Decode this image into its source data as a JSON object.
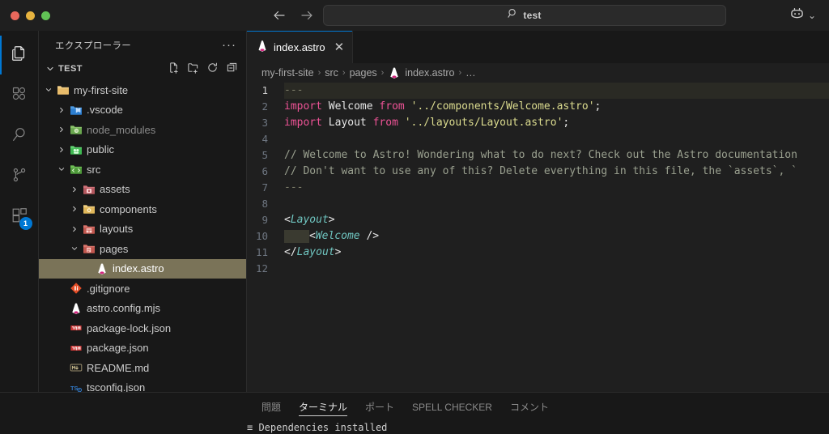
{
  "titlebar": {
    "back_label": "←",
    "forward_label": "→",
    "search_value": "test",
    "search_icon": "search-icon",
    "copilot_icon": "copilot-icon",
    "copilot_chevron": "⌄"
  },
  "activitybar": {
    "items": [
      {
        "name": "explorer",
        "icon": "files-icon",
        "active": true,
        "badge": ""
      },
      {
        "name": "figma",
        "icon": "figma-icon",
        "active": false,
        "badge": ""
      },
      {
        "name": "search",
        "icon": "search-icon",
        "active": false,
        "badge": ""
      },
      {
        "name": "source-control",
        "icon": "source-control-icon",
        "active": false,
        "badge": ""
      },
      {
        "name": "extensions",
        "icon": "extensions-icon",
        "active": false,
        "badge": "1"
      }
    ]
  },
  "sidebar": {
    "title": "エクスプローラー",
    "more_label": "···",
    "section": {
      "label": "TEST",
      "expanded": true,
      "actions": [
        {
          "name": "new-file",
          "label": "新しいファイル"
        },
        {
          "name": "new-folder",
          "label": "新しいフォルダー"
        },
        {
          "name": "refresh",
          "label": "最新の情報に更新"
        },
        {
          "name": "collapse-all",
          "label": "フォルダーを折りたたむ"
        }
      ]
    },
    "tree": [
      {
        "label": "my-first-site",
        "type": "folder",
        "icon": "folder-open-icon",
        "indent": 1,
        "expanded": true,
        "selected": false,
        "dim": false
      },
      {
        "label": ".vscode",
        "type": "folder",
        "icon": "folder-vscode-icon",
        "indent": 2,
        "expanded": false,
        "selected": false,
        "dim": false
      },
      {
        "label": "node_modules",
        "type": "folder",
        "icon": "folder-node-icon",
        "indent": 2,
        "expanded": false,
        "selected": false,
        "dim": true
      },
      {
        "label": "public",
        "type": "folder",
        "icon": "folder-public-icon",
        "indent": 2,
        "expanded": false,
        "selected": false,
        "dim": false
      },
      {
        "label": "src",
        "type": "folder",
        "icon": "folder-src-icon",
        "indent": 2,
        "expanded": true,
        "selected": false,
        "dim": false
      },
      {
        "label": "assets",
        "type": "folder",
        "icon": "folder-assets-icon",
        "indent": 3,
        "expanded": false,
        "selected": false,
        "dim": false
      },
      {
        "label": "components",
        "type": "folder",
        "icon": "folder-components-icon",
        "indent": 3,
        "expanded": false,
        "selected": false,
        "dim": false
      },
      {
        "label": "layouts",
        "type": "folder",
        "icon": "folder-layouts-icon",
        "indent": 3,
        "expanded": false,
        "selected": false,
        "dim": false
      },
      {
        "label": "pages",
        "type": "folder",
        "icon": "folder-pages-icon",
        "indent": 3,
        "expanded": true,
        "selected": false,
        "dim": false
      },
      {
        "label": "index.astro",
        "type": "file",
        "icon": "astro-icon",
        "indent": 4,
        "expanded": null,
        "selected": true,
        "dim": false
      },
      {
        "label": ".gitignore",
        "type": "file",
        "icon": "git-icon",
        "indent": 2,
        "expanded": null,
        "selected": false,
        "dim": false
      },
      {
        "label": "astro.config.mjs",
        "type": "file",
        "icon": "astro-icon",
        "indent": 2,
        "expanded": null,
        "selected": false,
        "dim": false
      },
      {
        "label": "package-lock.json",
        "type": "file",
        "icon": "npm-icon",
        "indent": 2,
        "expanded": null,
        "selected": false,
        "dim": false
      },
      {
        "label": "package.json",
        "type": "file",
        "icon": "npm-icon",
        "indent": 2,
        "expanded": null,
        "selected": false,
        "dim": false
      },
      {
        "label": "README.md",
        "type": "file",
        "icon": "markdown-icon",
        "indent": 2,
        "expanded": null,
        "selected": false,
        "dim": false
      },
      {
        "label": "tsconfig.json",
        "type": "file",
        "icon": "tsconfig-icon",
        "indent": 2,
        "expanded": null,
        "selected": false,
        "dim": false
      }
    ]
  },
  "editor": {
    "tabs": [
      {
        "label": "index.astro",
        "icon": "astro-icon",
        "active": true,
        "close_label": "✕"
      }
    ],
    "breadcrumbs": [
      {
        "label": "my-first-site",
        "icon": ""
      },
      {
        "label": "src",
        "icon": ""
      },
      {
        "label": "pages",
        "icon": ""
      },
      {
        "label": "index.astro",
        "icon": "astro-icon"
      },
      {
        "label": "…",
        "icon": ""
      }
    ],
    "separator": "›",
    "lines": [
      {
        "num": "1",
        "highlight": true,
        "tokens": [
          {
            "t": "fm",
            "s": "---"
          }
        ]
      },
      {
        "num": "2",
        "highlight": false,
        "tokens": [
          {
            "t": "kw",
            "s": "import"
          },
          {
            "t": "plain",
            "s": " Welcome "
          },
          {
            "t": "kw",
            "s": "from"
          },
          {
            "t": "plain",
            "s": " "
          },
          {
            "t": "str",
            "s": "'../components/Welcome.astro'"
          },
          {
            "t": "punct",
            "s": ";"
          }
        ]
      },
      {
        "num": "3",
        "highlight": false,
        "tokens": [
          {
            "t": "kw",
            "s": "import"
          },
          {
            "t": "plain",
            "s": " Layout "
          },
          {
            "t": "kw",
            "s": "from"
          },
          {
            "t": "plain",
            "s": " "
          },
          {
            "t": "str",
            "s": "'../layouts/Layout.astro'"
          },
          {
            "t": "punct",
            "s": ";"
          }
        ]
      },
      {
        "num": "4",
        "highlight": false,
        "tokens": []
      },
      {
        "num": "5",
        "highlight": false,
        "tokens": [
          {
            "t": "cmt",
            "s": "// Welcome to Astro! Wondering what to do next? Check out the Astro documentation"
          }
        ]
      },
      {
        "num": "6",
        "highlight": false,
        "tokens": [
          {
            "t": "cmt",
            "s": "// Don't want to use any of this? Delete everything in this file, the `assets`, `"
          }
        ]
      },
      {
        "num": "7",
        "highlight": false,
        "tokens": [
          {
            "t": "fm",
            "s": "---"
          }
        ]
      },
      {
        "num": "8",
        "highlight": false,
        "tokens": []
      },
      {
        "num": "9",
        "highlight": false,
        "tokens": [
          {
            "t": "punct",
            "s": "<"
          },
          {
            "t": "tag",
            "s": "Layout"
          },
          {
            "t": "punct",
            "s": ">"
          }
        ]
      },
      {
        "num": "10",
        "highlight": false,
        "tokens": [
          {
            "t": "ws",
            "s": "    "
          },
          {
            "t": "punct",
            "s": "<"
          },
          {
            "t": "tag",
            "s": "Welcome"
          },
          {
            "t": "punct",
            "s": " />"
          }
        ]
      },
      {
        "num": "11",
        "highlight": false,
        "tokens": [
          {
            "t": "punct",
            "s": "</"
          },
          {
            "t": "tag",
            "s": "Layout"
          },
          {
            "t": "punct",
            "s": ">"
          }
        ]
      },
      {
        "num": "12",
        "highlight": false,
        "tokens": []
      }
    ]
  },
  "panel": {
    "tabs": [
      {
        "label": "問題",
        "active": false
      },
      {
        "label": "ターミナル",
        "active": true
      },
      {
        "label": "ポート",
        "active": false
      },
      {
        "label": "SPELL CHECKER",
        "active": false
      },
      {
        "label": "コメント",
        "active": false
      }
    ],
    "terminal_line": "≡ Dependencies installed"
  },
  "colors": {
    "accent": "#0078d4",
    "selection": "#7a7358",
    "editor_bg": "#1f1f1f",
    "sidebar_bg": "#181818",
    "keyword": "#ee5396",
    "string": "#dcdc8f",
    "comment": "#9aa08f",
    "tag": "#6fc5c0"
  }
}
